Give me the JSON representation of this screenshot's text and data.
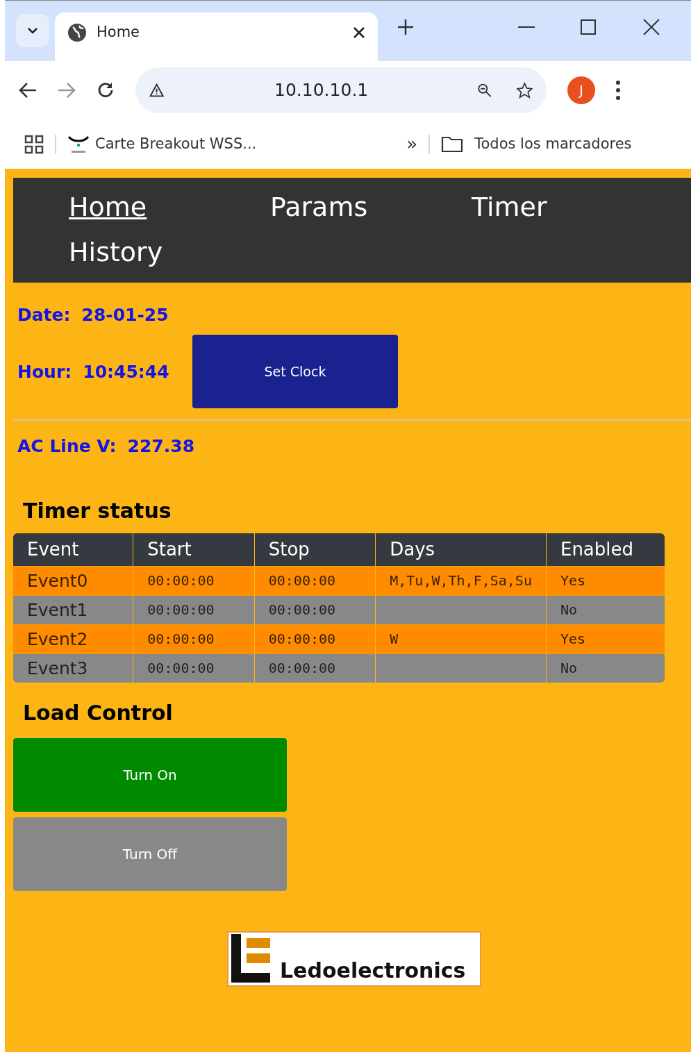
{
  "browser": {
    "tab_title": "Home",
    "address": "10.10.10.1",
    "profile_initial": "J",
    "bookmarks": [
      {
        "label": "Carte Breakout WSS..."
      }
    ],
    "all_bookmarks": "Todos los marcadores",
    "overflow": "»"
  },
  "nav": [
    {
      "label": "Home",
      "selected": true
    },
    {
      "label": "Params",
      "selected": false
    },
    {
      "label": "Timer",
      "selected": false
    },
    {
      "label": "History",
      "selected": false
    }
  ],
  "clock": {
    "date_label": "Date:",
    "date": "28-01-25",
    "hour_label": "Hour:",
    "hour": "10:45:44",
    "button": "Set Clock"
  },
  "ac_line": {
    "label": "AC Line V:",
    "value": "227.38"
  },
  "timer_status": {
    "title": "Timer status",
    "columns": [
      "Event",
      "Start",
      "Stop",
      "Days",
      "Enabled"
    ],
    "rows": [
      {
        "event": "Event0",
        "start": "00:00:00",
        "stop": "00:00:00",
        "days": "M,Tu,W,Th,F,Sa,Su",
        "enabled": "Yes",
        "active": true
      },
      {
        "event": "Event1",
        "start": "00:00:00",
        "stop": "00:00:00",
        "days": "",
        "enabled": "No",
        "active": false
      },
      {
        "event": "Event2",
        "start": "00:00:00",
        "stop": "00:00:00",
        "days": "W",
        "enabled": "Yes",
        "active": true
      },
      {
        "event": "Event3",
        "start": "00:00:00",
        "stop": "00:00:00",
        "days": "",
        "enabled": "No",
        "active": false
      }
    ]
  },
  "load_control": {
    "title": "Load Control",
    "buttons": [
      {
        "label": "Turn On",
        "kind": "on"
      },
      {
        "label": "Turn Off",
        "kind": "off"
      }
    ]
  },
  "logo": {
    "text": "Ledoelectronics"
  }
}
